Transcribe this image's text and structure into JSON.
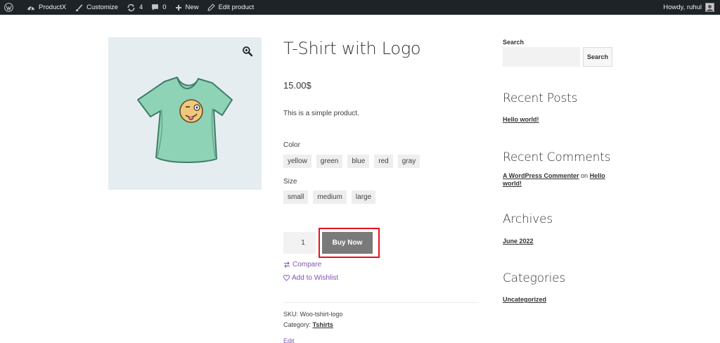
{
  "admin_bar": {
    "site_name": "ProductX",
    "customize": "Customize",
    "updates_count": "4",
    "comments_count": "0",
    "new": "New",
    "edit_product": "Edit product",
    "howdy": "Howdy, ruhul"
  },
  "product": {
    "title": "T-Shirt with Logo",
    "price": "15.00$",
    "description": "This is a simple product.",
    "color_label": "Color",
    "colors": [
      "yellow",
      "green",
      "blue",
      "red",
      "gray"
    ],
    "size_label": "Size",
    "sizes": [
      "small",
      "medium",
      "large"
    ],
    "quantity": "1",
    "buy_now": "Buy Now",
    "compare": "Compare",
    "wishlist": "Add to Wishlist",
    "sku_label": "SKU:",
    "sku": "Woo-tshirt-logo",
    "category_label": "Category:",
    "category": "Tshirts",
    "edit": "Edit"
  },
  "sidebar": {
    "search_label": "Search",
    "search_button": "Search",
    "recent_posts_title": "Recent Posts",
    "recent_post": "Hello world!",
    "recent_comments_title": "Recent Comments",
    "comment_author": "A WordPress Commenter",
    "comment_on": "on",
    "comment_post": "Hello world!",
    "archives_title": "Archives",
    "archive": "June 2022",
    "categories_title": "Categories",
    "category": "Uncategorized"
  },
  "colors": {
    "admin_bar_bg": "#1d2327",
    "accent_purple": "#7f54b3",
    "buy_now_bg": "#7a7a7a",
    "highlight_red": "#e8111d",
    "shirt_green": "#8fd3b6"
  },
  "icons": [
    "wordpress-icon",
    "customize-brush-icon",
    "updates-icon",
    "comment-icon",
    "plus-icon",
    "pencil-icon",
    "zoom-icon",
    "compare-icon",
    "heart-icon"
  ]
}
